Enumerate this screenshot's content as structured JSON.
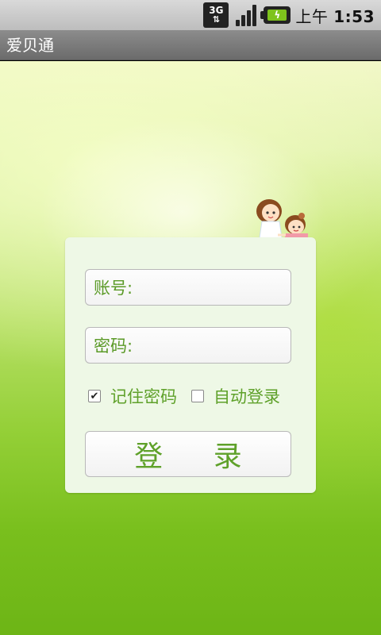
{
  "status_bar": {
    "network": "3G",
    "time_prefix": "上午",
    "time": "1:53",
    "icons": [
      "network-3g-icon",
      "signal-icon",
      "battery-charging-icon"
    ]
  },
  "app": {
    "title": "爱贝通"
  },
  "login": {
    "account_label": "账号:",
    "account_value": "",
    "password_label": "密码:",
    "password_value": "",
    "remember_password_label": "记住密码",
    "remember_password_checked": true,
    "auto_login_label": "自动登录",
    "auto_login_checked": false,
    "login_button_label": "登 录"
  },
  "colors": {
    "accent_text": "#5fa12a",
    "card_bg": "#eef8e6",
    "title_bar": "#7a7a7a"
  }
}
